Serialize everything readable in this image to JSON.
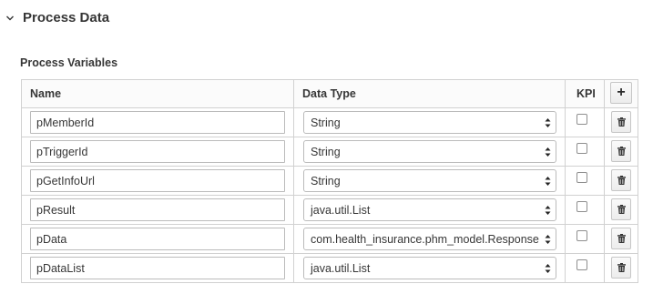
{
  "section": {
    "title": "Process Data"
  },
  "variables_title": "Process Variables",
  "table": {
    "headers": {
      "name": "Name",
      "data_type": "Data Type",
      "kpi": "KPI",
      "add": "+"
    },
    "rows": [
      {
        "name": "pMemberId",
        "data_type": "String",
        "kpi": false
      },
      {
        "name": "pTriggerId",
        "data_type": "String",
        "kpi": false
      },
      {
        "name": "pGetInfoUrl",
        "data_type": "String",
        "kpi": false
      },
      {
        "name": "pResult",
        "data_type": "java.util.List",
        "kpi": false
      },
      {
        "name": "pData",
        "data_type": "com.health_insurance.phm_model.Response",
        "kpi": false
      },
      {
        "name": "pDataList",
        "data_type": "java.util.List",
        "kpi": false
      }
    ]
  },
  "icons": {
    "collapse": "chevron-down-icon",
    "delete": "trash-icon",
    "select": "updown-arrows-icon"
  }
}
